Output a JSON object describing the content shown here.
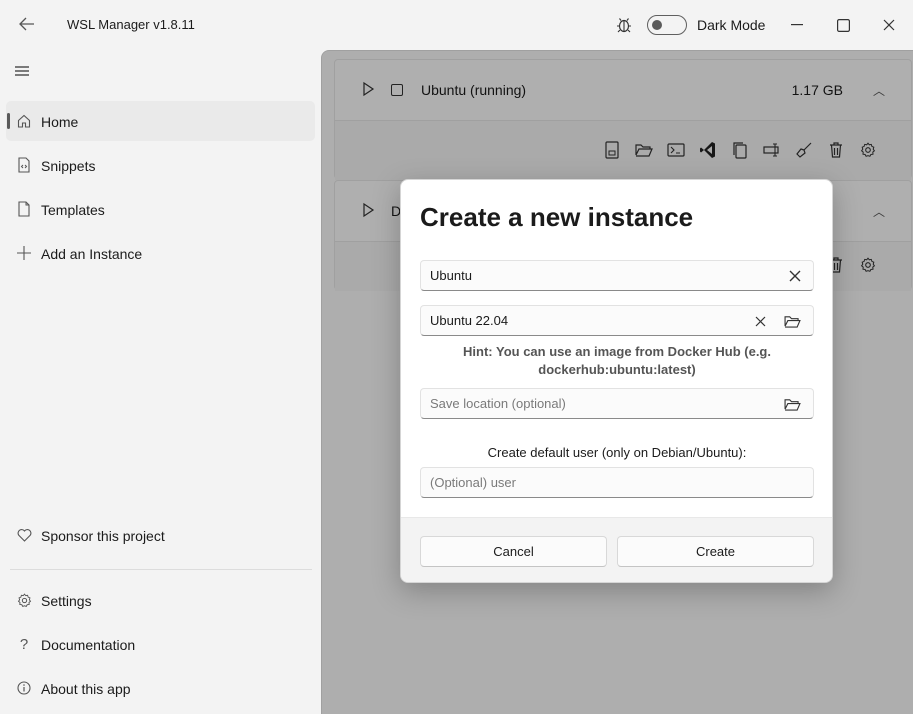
{
  "window": {
    "title": "WSL Manager v1.8.11",
    "dark_mode_label": "Dark Mode",
    "dark_mode_on": false
  },
  "sidebar": {
    "top_items": [
      {
        "label": "Home",
        "icon": "home-icon",
        "active": true
      },
      {
        "label": "Snippets",
        "icon": "snippet-icon"
      },
      {
        "label": "Templates",
        "icon": "template-icon"
      },
      {
        "label": "Add an Instance",
        "icon": "plus-icon"
      }
    ],
    "bottom_items": [
      {
        "label": "Sponsor this project",
        "icon": "heart-icon"
      },
      {
        "label": "Settings",
        "icon": "gear-icon"
      },
      {
        "label": "Documentation",
        "icon": "question-icon"
      },
      {
        "label": "About this app",
        "icon": "info-icon"
      }
    ]
  },
  "instances": [
    {
      "name": "Ubuntu (running)",
      "size": "1.17 GB"
    },
    {
      "name": "D",
      "size": ""
    }
  ],
  "dialog": {
    "title": "Create a new instance",
    "name_value": "Ubuntu",
    "image_value": "Ubuntu 22.04",
    "hint": "Hint: You can use an image from Docker Hub (e.g. dockerhub:ubuntu:latest)",
    "save_location_placeholder": "Save location (optional)",
    "user_label": "Create default user (only on Debian/Ubuntu):",
    "user_placeholder": "(Optional) user",
    "cancel_label": "Cancel",
    "create_label": "Create"
  }
}
